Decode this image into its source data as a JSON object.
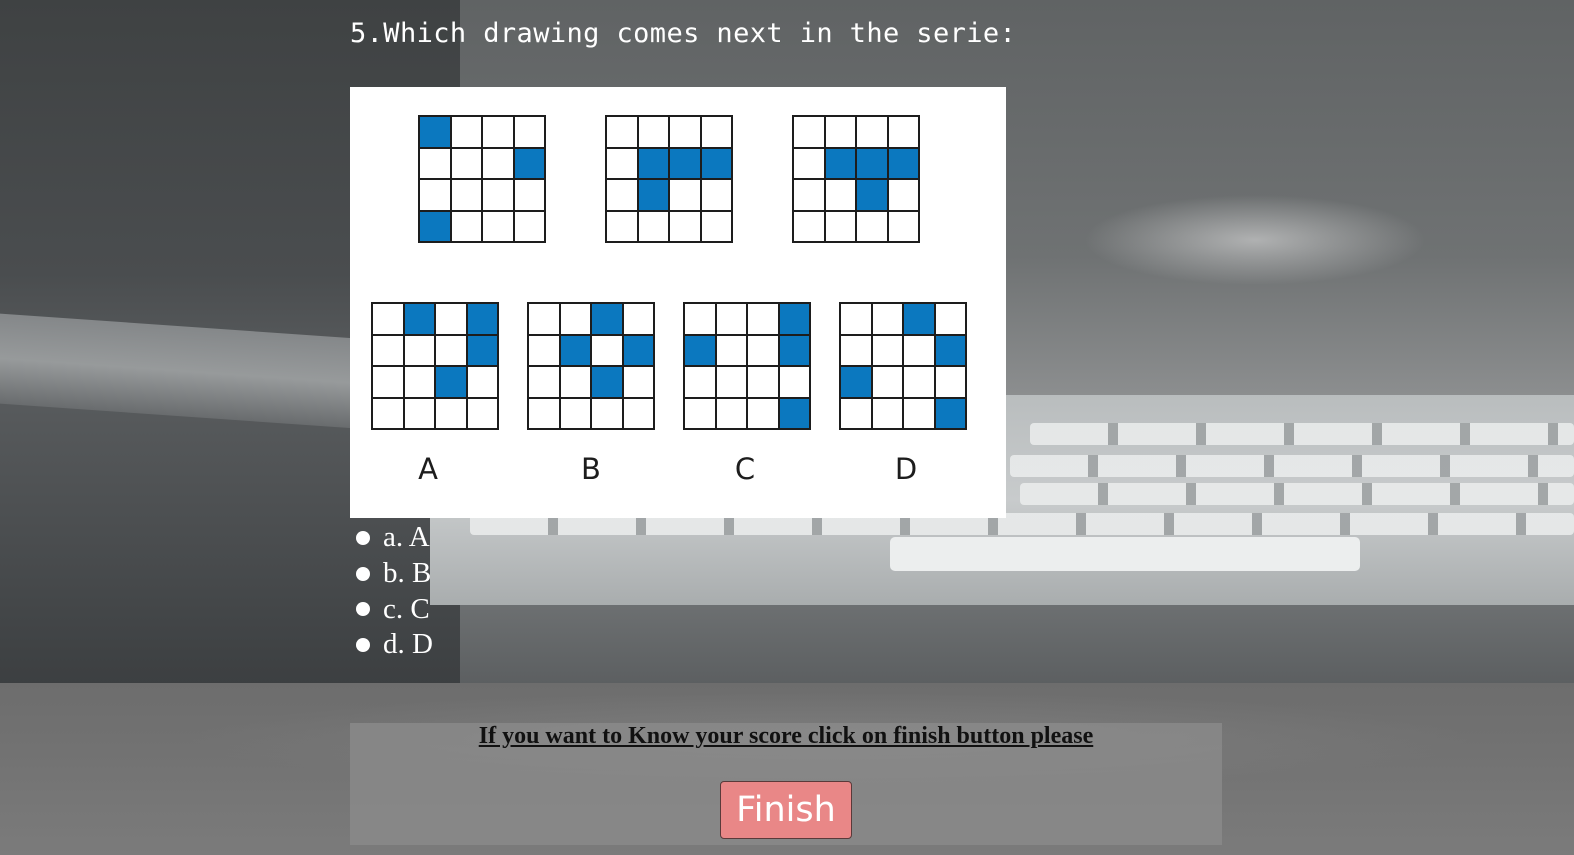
{
  "question": {
    "title": "5.Which drawing comes next in the serie:"
  },
  "figure": {
    "series": [
      {
        "filled": [
          0,
          7,
          12
        ]
      },
      {
        "filled": [
          5,
          6,
          7,
          9
        ]
      },
      {
        "filled": [
          5,
          6,
          7,
          10
        ]
      }
    ],
    "choices": [
      {
        "letter": "A",
        "filled": [
          1,
          3,
          7,
          10
        ]
      },
      {
        "letter": "B",
        "filled": [
          2,
          5,
          7,
          10
        ]
      },
      {
        "letter": "C",
        "filled": [
          3,
          4,
          7,
          15
        ]
      },
      {
        "letter": "D",
        "filled": [
          2,
          7,
          8,
          15
        ]
      }
    ],
    "fill_color": "#0b78bf"
  },
  "options": [
    {
      "label": "a. A"
    },
    {
      "label": "b. B"
    },
    {
      "label": "c. C"
    },
    {
      "label": "d. D"
    }
  ],
  "footer": {
    "message": "If you want to Know your score click on finish button please",
    "finish_label": "Finish",
    "finish_color": "#e98787"
  }
}
